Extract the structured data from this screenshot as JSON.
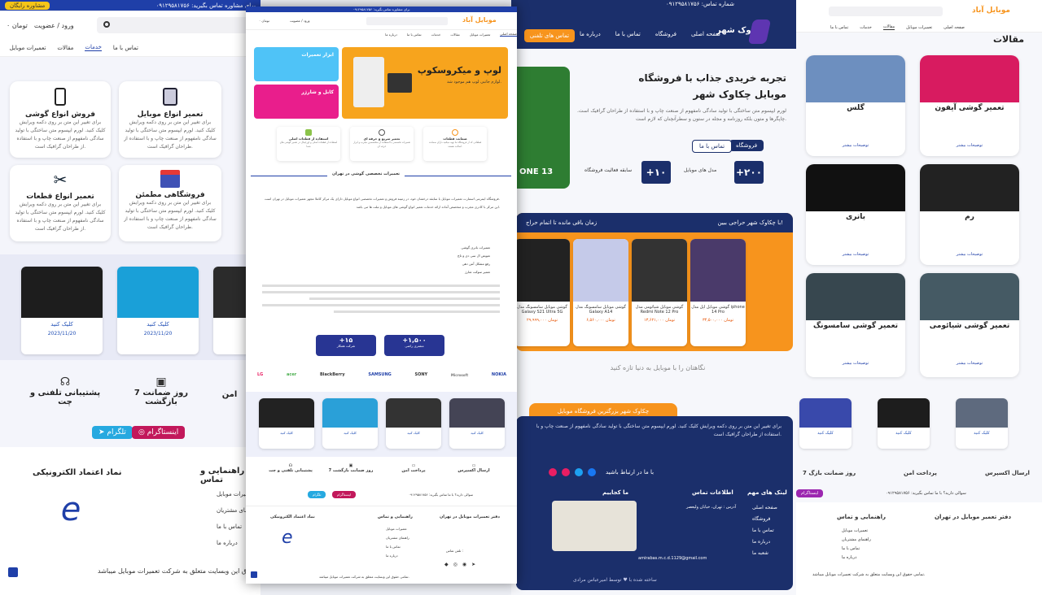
{
  "left": {
    "topbar": {
      "phone": "۰۹۱۲۹۵۸۱۷۵۶",
      "consult": "برای مشاوره تماس بگیرید:",
      "badge": "مشاوره رایگان"
    },
    "header": {
      "login": "ورود / عضویت",
      "cart": "۰ تومان",
      "search_placeholder": "جستجو"
    },
    "nav": [
      "تماس با ما",
      "خدمات",
      "مقالات",
      "تعمیرات موبایل"
    ],
    "services": [
      {
        "title": "فروش انواع گوشی",
        "desc": "برای تغییر این متن بر روی دکمه ویرایش کلیک کنید. لورم ایپسوم متن ساختگی با تولید سادگی نامفهوم از صنعت چاپ و با استفاده از طراحان گرافیک است."
      },
      {
        "title": "تعمیر انواع موبایل",
        "desc": "برای تغییر این متن بر روی دکمه ویرایش کلیک کنید. لورم ایپسوم متن ساختگی با تولید سادگی نامفهوم از صنعت چاپ و با استفاده از طراحان گرافیک است."
      },
      {
        "title": "تعمیر انواع قطعات",
        "desc": "برای تغییر این متن بر روی دکمه ویرایش کلیک کنید. لورم ایپسوم متن ساختگی با تولید سادگی نامفهوم از صنعت چاپ و با استفاده از طراحان گرافیک است."
      },
      {
        "title": "فروشگاهی مطمئن",
        "desc": "برای تغییر این متن بر روی دکمه ویرایش کلیک کنید. لورم ایپسوم متن ساختگی با تولید سادگی نامفهوم از صنعت چاپ و با استفاده از طراحان گرافیک است."
      }
    ],
    "products": [
      {
        "label": "کلیک کنید",
        "date": "2023/11/20"
      },
      {
        "label": "کلیک کنید",
        "date": "2023/11/20"
      }
    ],
    "features": [
      "پشتیبانی تلفنی و چت",
      "7 روز ضمانت بازگشت",
      "امن"
    ],
    "social": {
      "telegram": "تلگرام",
      "instagram": "اینستاگرام"
    },
    "footer": {
      "trust": "نماد اعتماد الکترونیکی",
      "guide": "راهنمایی و تماس",
      "links": [
        "تعمیرات موبایل",
        "راهنمای مشتریان",
        "تماس با ما",
        "درباره ما"
      ],
      "copyright": "تمامی حقوق این وبسایت متعلق به شرکت تعمیرات موبایل میباشد."
    }
  },
  "center": {
    "topbar": {
      "phone": "۰۹۱۲۹۵۸۱۷۵۶",
      "consult": "برای مشاوره تماس بگیرید:"
    },
    "logo": "موبایل آباد",
    "header": {
      "login": "ورود / عضویت",
      "cart": "۰ تومان",
      "search_placeholder": "جستجو"
    },
    "nav": [
      "صفحه اصلی",
      "تعمیرات موبایل",
      "مقالات",
      "خدمات",
      "تماس با ما",
      "درباره ما"
    ],
    "banner": {
      "title": "لوپ و میکروسکوپ",
      "subtitle": "لوازم جانبی لوپ هم موجود شد.",
      "side1": "ابزار تعمیرات",
      "side2": "کابل و شارژر"
    },
    "features": [
      {
        "title": "ضمانت قطعات",
        "desc": "قطعاتی که از فروشگاه ما تهیه میکنید دارای ضمانت اصالت هستند."
      },
      {
        "title": "تعمیر سریع و حرفه ای",
        "desc": "تعمیرات تخصصی با استفاده از متخصصین مجرب و ابزار حرفه ای"
      },
      {
        "title": "استفاده از قطعات اصلی",
        "desc": "استفاده از قطعات اصلی و اورجینال در تعمیر گوشی های شما"
      }
    ],
    "section_title": "تعمیرات تخصصی گوشی در تهران",
    "paragraphs": [
      "فروشگاه اینترنتی اسمارت تعمیرات موبایل با سابقه درخشان خود، در زمینه فروش و تعمیرات تخصصی انواع موبایل دارای یک مرکز کاملا مجهز تعمیرات موبایل در تهران است.",
      "این مرکز با کادری مجرب و متخصص آماده ارائه خدمات تعمیر انواع گوشی های موبایل و تبلت ها می باشد."
    ],
    "bullets": [
      "تعمیرات باتری گوشی",
      "تعویض ال سی دی و تاچ",
      "رفع مشکل آنتن دهی",
      "تعمیر سوکت شارژ"
    ],
    "stats": [
      {
        "value": "+۱,۵۰۰",
        "label": "مشتری راضی"
      },
      {
        "value": "+۱۵",
        "label": "شرکت همکار"
      }
    ],
    "brands": [
      "NOKIA",
      "Microsoft",
      "SONY",
      "SAMSUNG",
      "BlackBerry",
      "acer",
      "LG"
    ],
    "products": [
      {
        "label": "کلیک کنید"
      },
      {
        "label": "کلیک کنید"
      },
      {
        "label": "کلیک کنید"
      },
      {
        "label": "کلیک کنید"
      }
    ],
    "services": [
      "ارسال اکسپرس",
      "پرداخت امن",
      "7 روز ضمانت بازگشت",
      "پشتیبانی تلفنی و چت"
    ],
    "social": {
      "telegram": "تلگرام",
      "instagram": "اینستاگرام",
      "consult": "سوالی دارید؟ با ما تماس بگیرید:",
      "phone": "۰۹۱۲۹۵۸۱۷۵۶"
    },
    "footer": {
      "office": "دفتر تعمیرات موبایل در تهران",
      "guide": "راهنمایی و تماس",
      "trust": "نماد اعتماد الکترونیکی",
      "hours": "تلفن تماس :",
      "links": [
        "تعمیرات موبایل",
        "راهنمای مشتریان",
        "تماس با ما",
        "درباره ما"
      ],
      "copyright": "تمامی حقوق این وبسایت متعلق به شرکت تعمیرات موبایل میباشد."
    }
  },
  "mid2": {
    "topbar": {
      "phone": "۰۹۱۲۹۵۸۱۷۵۶",
      "label": "شماره تماس:"
    },
    "logo": "چکاوک شهر",
    "nav": [
      "صفحه اصلی",
      "فروشگاه",
      "تماس با ما",
      "درباره ما"
    ],
    "cta": "تماس های تلفنی",
    "hero": {
      "title": "تجربه خریدی جذاب با فروشگاه",
      "title2": "موبایل چکاوک شهر",
      "desc": "لورم ایپسوم متن ساختگی با تولید سادگی نامفهوم از صنعت چاپ و با استفاده از طراحان گرافیک است. چاپگرها و متون بلکه روزنامه و مجله در ستون و سطرآنچنان که لازم است.",
      "btn_shop": "فروشگاه",
      "btn_contact": "تماس با ما"
    },
    "stats": [
      {
        "value": "+۲۰۰",
        "label": "مدل های موبایل"
      },
      {
        "value": "+۱۰",
        "label": "سابقه فعالیت فروشگاه"
      }
    ],
    "sale": {
      "title": "با چکاوک شهر حراجی ببین!",
      "timer": "زمان باقی مانده تا اتمام حراج"
    },
    "products": [
      {
        "name": "گوشی موبایل اپل مدل iphone 14 Pro",
        "price": "۳۴,۵۰۰,۰۰۰ تومان"
      },
      {
        "name": "گوشی موبایل شیائومی مدل Redmi Note 12 Pro",
        "price": "۱۳,۶۲۱,۰۰۰ تومان"
      },
      {
        "name": "گوشی موبایل سامسونگ مدل Galaxy A14",
        "price": "۶,۵۶۰,۰۰۰ تومان"
      },
      {
        "name": "گوشی موبایل سامسونگ مدل Galaxy S21 Ultra 5G",
        "price": "۲۹,۹۹۹,۰۰۰ تومان"
      }
    ],
    "tagline": "نگاهتان را با موبایل به دنیا تازه کنید",
    "footer_tab": "چکاوک شهر بزرگترین فروشگاه موبایل",
    "footer_desc": "برای تغییر این متن بر روی دکمه ویرایش کلیک کنید. لورم ایپسوم متن ساختگی با تولید سادگی نامفهوم از صنعت چاپ و با استفاده از طراحان گرافیک است.",
    "follow": "با ما در ارتباط باشید",
    "cols": {
      "links": "لینک های مهم",
      "contact": "اطلاعات تماس",
      "map": "ما کجاییم"
    },
    "links": [
      "صفحه اصلی",
      "فروشگاه",
      "تماس با ما",
      "درباره ما",
      "شعبه ما"
    ],
    "address": "آدرس : تهران، خیابان ولیعصر",
    "email": "amirabas.m.c.d.1129@gmail.com",
    "credit": "ساخته شده با ♥ توسط امیرعباس مرادی"
  },
  "right": {
    "logo": "موبایل آباد",
    "nav": [
      "صفحه اصلی",
      "تعمیرات موبایل",
      "مقالات",
      "خدمات",
      "تماس با ما"
    ],
    "section": "مقالات",
    "articles": [
      {
        "title": "تعمیر گوشی آیفون",
        "more": "توضیحات بیشتر"
      },
      {
        "title": "گلس",
        "more": "توضیحات بیشتر"
      },
      {
        "title": "رم",
        "more": "توضیحات بیشتر"
      },
      {
        "title": "باتری",
        "more": "توضیحات بیشتر"
      },
      {
        "title": "تعمیر گوشی شیائومی",
        "more": "توضیحات بیشتر"
      },
      {
        "title": "تعمیر گوشی سامسونگ",
        "more": "توضیحات بیشتر"
      }
    ],
    "products": [
      {
        "label": "کلیک کنید"
      },
      {
        "label": "کلیک کنید"
      },
      {
        "label": "کلیک کنید"
      }
    ],
    "services": [
      "ارسال اکسپرس",
      "پرداخت امن",
      "7 روز ضمانت بازگ"
    ],
    "consult": "سوالی دارید؟ با ما تماس بگیرید:",
    "phone": "۰۹۱۲۹۵۸۱۷۵۶",
    "instagram": "اینستاگرام",
    "office": "دفتر تعمیر موبایل در تهران",
    "guide": "راهنمایی و تماس",
    "links": [
      "تعمیرات موبایل",
      "راهنمای مشتریان",
      "تماس با ما",
      "درباره ما"
    ],
    "copyright": "تمامی حقوق این وبسایت متعلق به شرکت تعمیرات موبایل میباشد."
  },
  "colors": {
    "brand_blue": "#1f3fa8",
    "navy": "#1b2f6b",
    "orange": "#f7941d",
    "yellow": "#f5c518",
    "purple": "#9c27b0",
    "teal": "#26a9e0"
  }
}
